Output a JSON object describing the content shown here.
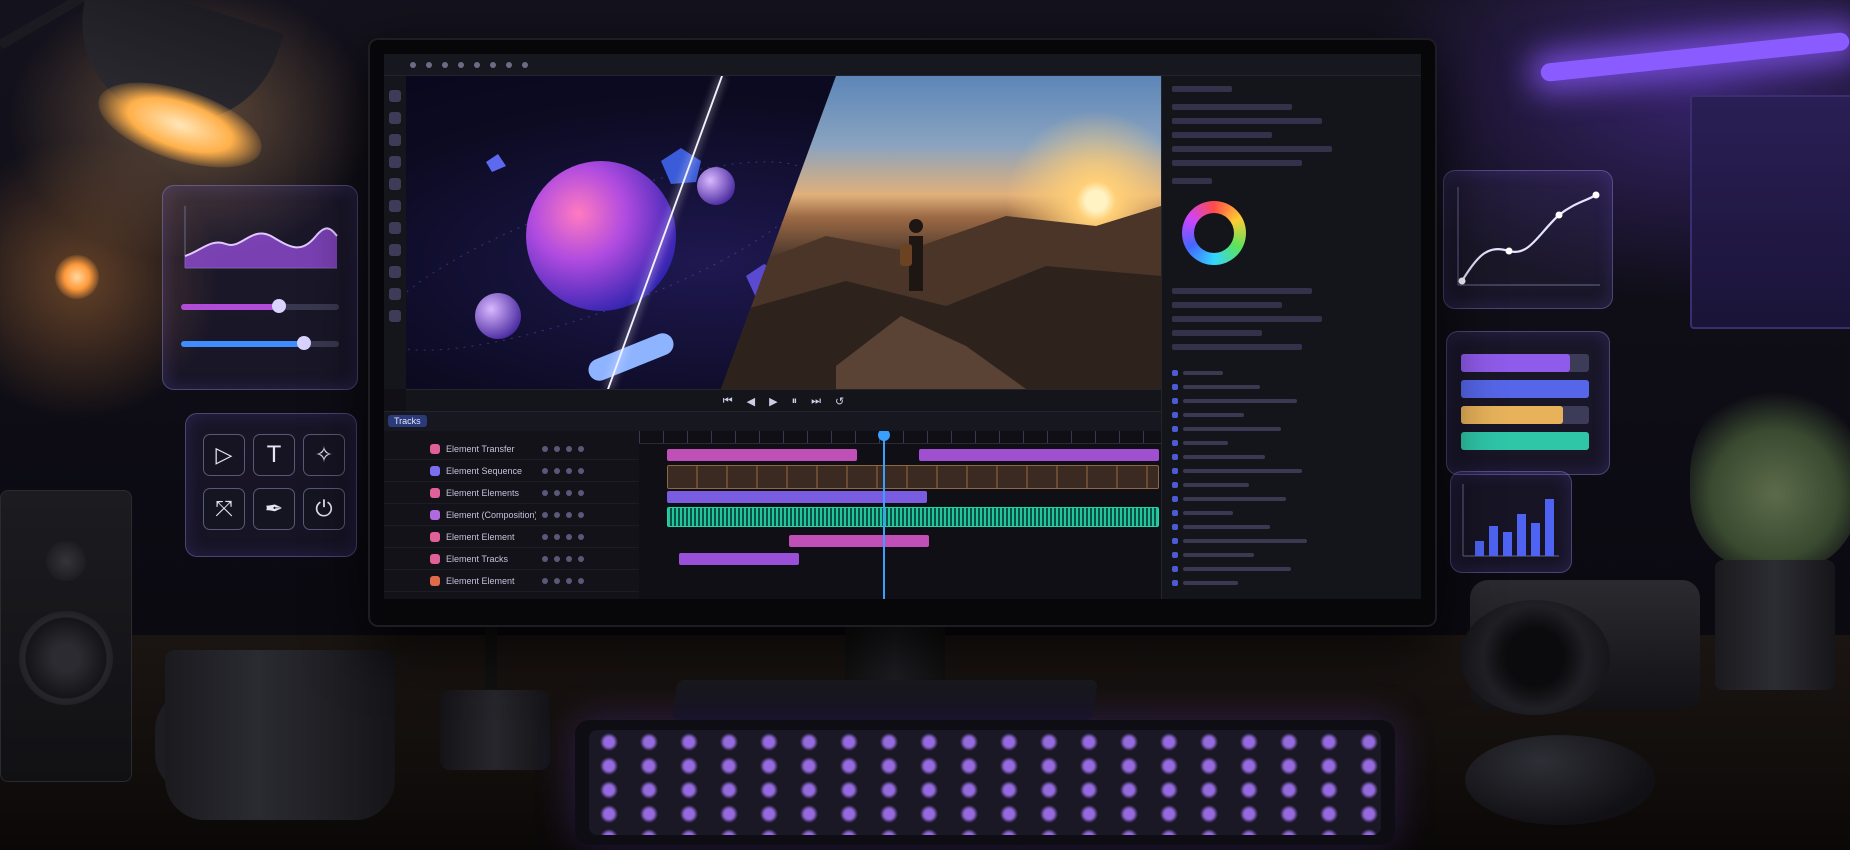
{
  "app": {
    "title": "",
    "transport_controls": [
      "⏮",
      "◀",
      "▶",
      "⏸",
      "⏭",
      "↺"
    ]
  },
  "timeline": {
    "tab_label": "Tracks",
    "tracks": [
      {
        "name": "Element Transfer",
        "color": "#e0609a"
      },
      {
        "name": "Element Sequence",
        "color": "#7b6ff0"
      },
      {
        "name": "Element Elements",
        "color": "#e0609a"
      },
      {
        "name": "Element (Composition)",
        "color": "#b06ae0"
      },
      {
        "name": "Element Element",
        "color": "#e0609a"
      },
      {
        "name": "Element Tracks",
        "color": "#e0609a"
      },
      {
        "name": "Element Element",
        "color": "#e06a4a"
      }
    ]
  },
  "floating_panels": {
    "tools": [
      {
        "icon": "play-icon",
        "glyph": "▷"
      },
      {
        "icon": "text-tool-icon",
        "glyph": "T"
      },
      {
        "icon": "shape-star-icon",
        "glyph": "✧"
      },
      {
        "icon": "transform-icon",
        "glyph": "⤧"
      },
      {
        "icon": "pen-tool-icon",
        "glyph": "✒"
      },
      {
        "icon": "power-icon",
        "glyph": "⏻"
      }
    ],
    "sliders": [
      {
        "name": "slider-magenta",
        "value": 0.62,
        "color": "#b14cd8"
      },
      {
        "name": "slider-blue",
        "value": 0.78,
        "color": "#3f8cff"
      }
    ],
    "levels": [
      {
        "value": 0.85,
        "color": "#8f5bea"
      },
      {
        "value": 1.0,
        "color": "#5566e8"
      },
      {
        "value": 0.8,
        "color": "#e7b25a"
      },
      {
        "value": 1.0,
        "color": "#2fc6a8"
      }
    ],
    "bars": [
      0.25,
      0.5,
      0.4,
      0.7,
      0.55,
      0.95
    ]
  },
  "colors": {
    "accent": "#3aa0ff",
    "purple": "#8a5cff",
    "audio": "#25d6a4",
    "clip_pink": "#c04fb8"
  }
}
